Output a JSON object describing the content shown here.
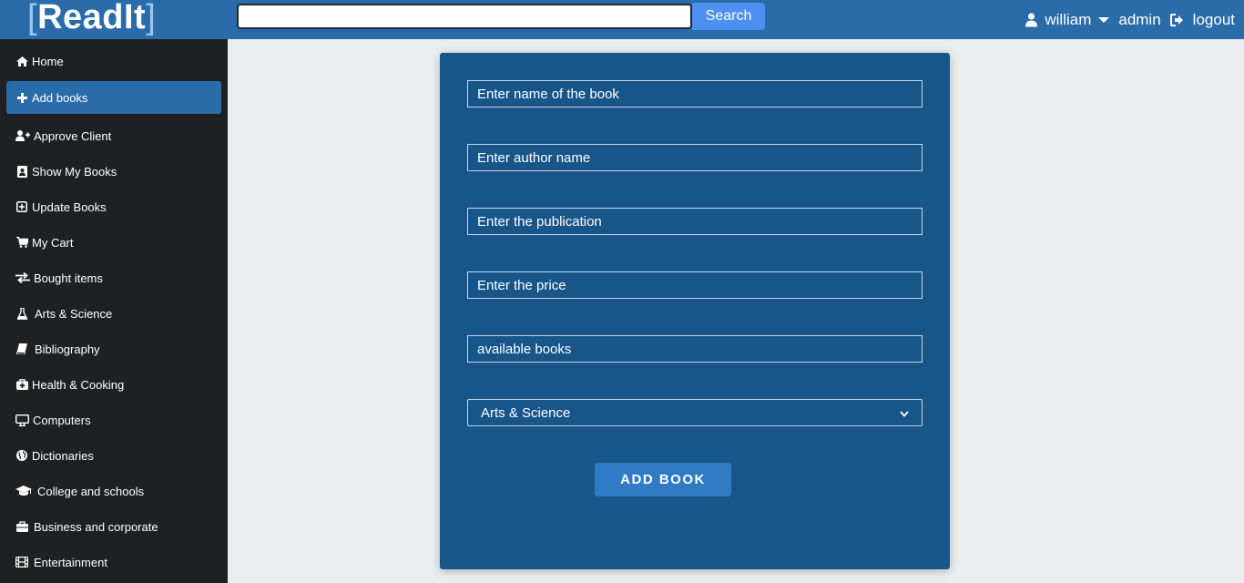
{
  "header": {
    "brand_open": "[",
    "brand_name": "ReadIt",
    "brand_close": "]",
    "search_value": "",
    "search_button": "Search",
    "user_name": "william",
    "role": "admin",
    "logout": "logout"
  },
  "sidebar": {
    "items": [
      {
        "label": "Home",
        "icon": "home-icon"
      },
      {
        "label": "Add books",
        "icon": "plus-icon"
      },
      {
        "label": "Approve Client",
        "icon": "user-plus-icon"
      },
      {
        "label": "Show My Books",
        "icon": "address-book-icon"
      },
      {
        "label": "Update Books",
        "icon": "plus-square-icon"
      },
      {
        "label": "My Cart",
        "icon": "cart-icon"
      },
      {
        "label": "Bought items",
        "icon": "exchange-icon"
      },
      {
        "label": "Arts & Science",
        "icon": "flask-icon"
      },
      {
        "label": "Bibliography",
        "icon": "book-icon"
      },
      {
        "label": "Health & Cooking",
        "icon": "medkit-icon"
      },
      {
        "label": "Computers",
        "icon": "desktop-icon"
      },
      {
        "label": "Dictionaries",
        "icon": "globe-icon"
      },
      {
        "label": "College and schools",
        "icon": "graduation-cap-icon"
      },
      {
        "label": "Business and corporate",
        "icon": "briefcase-icon"
      },
      {
        "label": "Entertainment",
        "icon": "film-icon"
      }
    ],
    "active_index": 1
  },
  "form": {
    "book_name_placeholder": "Enter name of the book",
    "author_placeholder": "Enter author name",
    "publication_placeholder": "Enter the publication",
    "price_placeholder": "Enter the price",
    "available_placeholder": "available books",
    "category_selected": "Arts & Science",
    "submit_label": "ADD BOOK"
  },
  "colors": {
    "header": "#2a6ba9",
    "sidebar": "#1f2023",
    "card": "#185589",
    "button": "#2f7bc4",
    "search_button": "#4e8ff2"
  }
}
